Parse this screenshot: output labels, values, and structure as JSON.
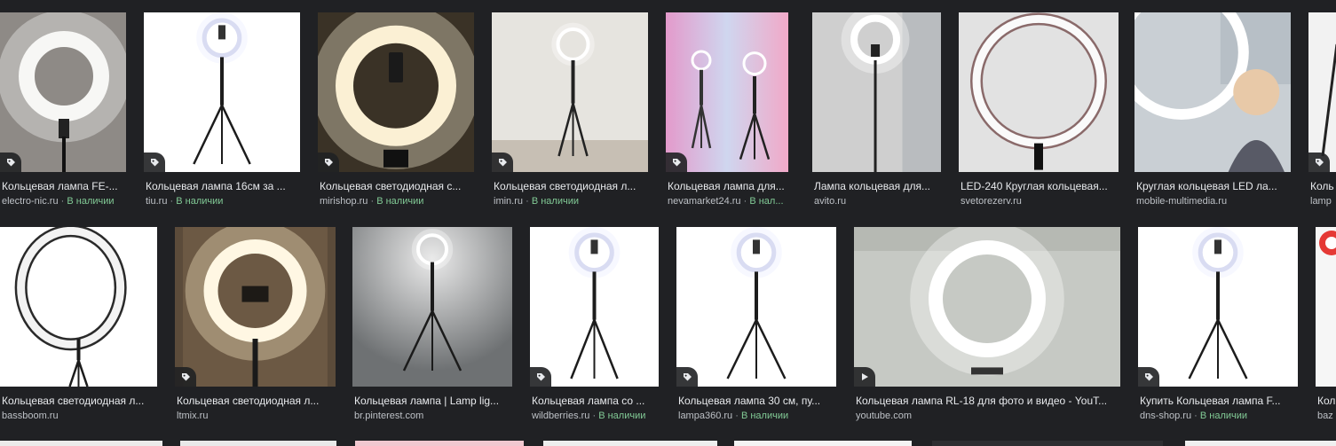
{
  "colors": {
    "background": "#202124",
    "title": "#e8eaed",
    "source": "#bdc1c6",
    "availability": "#81c995"
  },
  "availability_separator": "·",
  "rows": [
    {
      "items": [
        {
          "title": "Кольцевая лампа FE-...",
          "source": "electro-nic.ru",
          "availability": "В наличии",
          "badge": "tag-icon",
          "scene": "ring-closeup-gray"
        },
        {
          "title": "Кольцевая лампа 16см за ...",
          "source": "tiu.ru",
          "availability": "В наличии",
          "badge": "tag-icon",
          "scene": "tripod-white"
        },
        {
          "title": "Кольцевая светодиодная с...",
          "source": "mirishop.ru",
          "availability": "В наличии",
          "badge": "tag-icon",
          "scene": "ring-glow-dark"
        },
        {
          "title": "Кольцевая светодиодная л...",
          "source": "imin.ru",
          "availability": "В наличии",
          "badge": "tag-icon",
          "scene": "room-floor"
        },
        {
          "title": "Кольцевая лампа для...",
          "source": "nevamarket24.ru",
          "availability": "В нал...",
          "badge": "tag-icon",
          "scene": "pink-studio"
        },
        {
          "title": "Лампа кольцевая для...",
          "source": "avito.ru",
          "availability": "",
          "badge": "",
          "scene": "gray-room-tall"
        },
        {
          "title": "LED-240 Круглая кольцевая...",
          "source": "svetorezerv.ru",
          "availability": "",
          "badge": "",
          "scene": "big-ring-light"
        },
        {
          "title": "Круглая кольцевая LED ла...",
          "source": "mobile-multimedia.ru",
          "availability": "",
          "badge": "",
          "scene": "woman-ring"
        },
        {
          "title": "Коль",
          "source": "lamp",
          "availability": "",
          "badge": "tag-icon",
          "scene": "partial-white"
        }
      ]
    },
    {
      "items": [
        {
          "title": "Кольцевая светодиодная л...",
          "source": "bassboom.ru",
          "availability": "",
          "badge": "",
          "scene": "ring-angle-white"
        },
        {
          "title": "Кольцевая светодиодная л...",
          "source": "ltmix.ru",
          "availability": "",
          "badge": "tag-icon",
          "scene": "ring-glow-warm"
        },
        {
          "title": "Кольцевая лампа | Lamp lig...",
          "source": "br.pinterest.com",
          "availability": "",
          "badge": "",
          "scene": "studio-gray"
        },
        {
          "title": "Кольцевая лампа со ...",
          "source": "wildberries.ru",
          "availability": "В наличии",
          "badge": "tag-icon",
          "scene": "tripod-white"
        },
        {
          "title": "Кольцевая лампа 30 см, пу...",
          "source": "lampa360.ru",
          "availability": "В наличии",
          "badge": "tag-icon",
          "scene": "tripod-white"
        },
        {
          "title": "Кольцевая лампа RL-18 для фото и видео - YouT...",
          "source": "youtube.com",
          "availability": "",
          "badge": "play-icon",
          "scene": "youtube-ring"
        },
        {
          "title": "Купить Кольцевая лампа F...",
          "source": "dns-shop.ru",
          "availability": "В наличии",
          "badge": "tag-icon",
          "scene": "tripod-white"
        },
        {
          "title": "Кол",
          "source": "baz",
          "availability": "",
          "badge": "",
          "scene": "partial-rgb"
        }
      ]
    }
  ]
}
